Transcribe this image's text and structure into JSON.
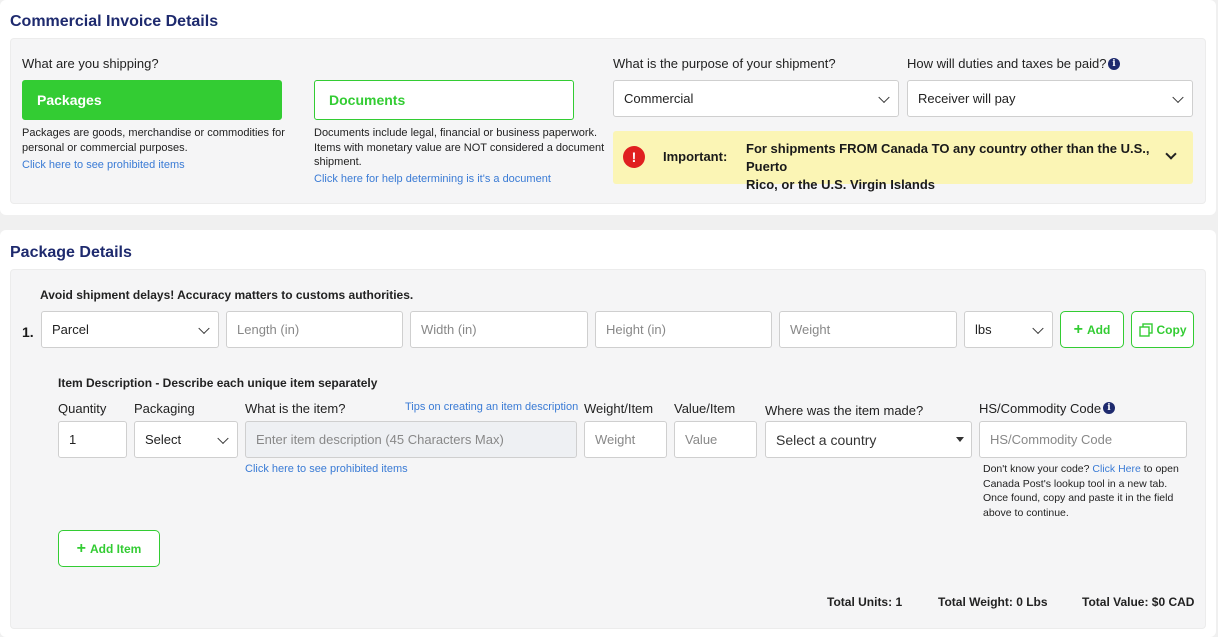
{
  "invoice": {
    "title": "Commercial Invoice Details",
    "shipping_question": "What are you shipping?",
    "packages_label": "Packages",
    "packages_desc_1": "Packages are goods, merchandise or commodities for",
    "packages_desc_2": "personal or commercial purposes.",
    "packages_link": "Click here to see prohibited items",
    "documents_label": "Documents",
    "documents_desc_1": "Documents include legal, financial or business paperwork.",
    "documents_desc_2": "Items with monetary value are NOT considered a document",
    "documents_desc_3": "shipment.",
    "documents_link": "Click here for help determining is it's a document",
    "purpose_question": "What is the purpose of your shipment?",
    "purpose_value": "Commercial",
    "duties_question": "How will duties and taxes be paid?",
    "duties_value": "Receiver will pay",
    "important_label": "Important:",
    "important_text_1": "For shipments FROM Canada TO any country other than the U.S., Puerto",
    "important_text_2": "Rico, or the U.S. Virgin Islands"
  },
  "package": {
    "title": "Package Details",
    "warning": "Avoid shipment delays! Accuracy matters to customs authorities.",
    "row_number": "1.",
    "type_value": "Parcel",
    "length_placeholder": "Length (in)",
    "width_placeholder": "Width (in)",
    "height_placeholder": "Height (in)",
    "weight_placeholder": "Weight",
    "unit_value": "lbs",
    "add_label": "Add",
    "copy_label": "Copy"
  },
  "item": {
    "heading": "Item Description - Describe each unique item separately",
    "quantity_label": "Quantity",
    "quantity_value": "1",
    "packaging_label": "Packaging",
    "packaging_value": "Select",
    "what_label": "What is the item?",
    "tips_link": "Tips on creating an item description",
    "description_placeholder": "Enter item description (45 Characters Max)",
    "prohibited_link": "Click here to see prohibited items",
    "weight_item_label": "Weight/Item",
    "weight_placeholder": "Weight",
    "value_item_label": "Value/Item",
    "value_placeholder": "Value",
    "made_label": "Where was the item made?",
    "country_value": "Select a country",
    "hs_label": "HS/Commodity Code",
    "hs_placeholder": "HS/Commodity Code",
    "hs_help_1": "Don't know your code?",
    "hs_help_link": "Click Here",
    "hs_help_2": "to open",
    "hs_help_3": "Canada Post's lookup tool in a new tab.",
    "hs_help_4": "Once found, copy and paste it in the field",
    "hs_help_5": "above to continue.",
    "add_item_label": "Add Item"
  },
  "totals": {
    "units": "Total Units: 1",
    "weight": "Total Weight: 0 Lbs",
    "value": "Total Value: $0 CAD"
  },
  "colors": {
    "accent_green": "#33cc33",
    "title_navy": "#1e2a6e",
    "link_blue": "#3a7bd5",
    "important_bg": "#fbf5b5",
    "alert_red": "#e02020"
  }
}
